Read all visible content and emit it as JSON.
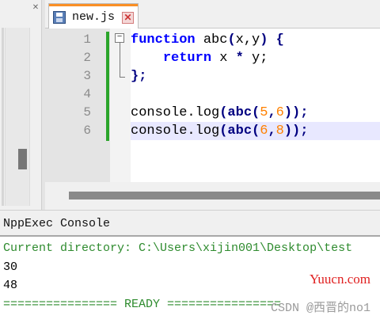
{
  "tab": {
    "filename": "new.js",
    "close_glyph": "✕"
  },
  "left_panel": {
    "close_glyph": "✕"
  },
  "editor": {
    "line_numbers": [
      "1",
      "2",
      "3",
      "4",
      "5",
      "6"
    ],
    "fold_glyph": "−",
    "lines": {
      "l1": {
        "kw": "function",
        "rest": " abc",
        "p1": "(",
        "args": "x,y",
        "p2": ")",
        "brace": " {"
      },
      "l2": {
        "indent": "    ",
        "kw": "return",
        "rest": " x ",
        "op": "*",
        "rest2": " y;"
      },
      "l3": {
        "text": "};"
      },
      "l5": {
        "a": "console.log",
        "b": "(abc(",
        "n1": "5",
        "c": ",",
        "n2": "6",
        "d": "));"
      },
      "l6": {
        "a": "console.log",
        "b": "(abc(",
        "n1": "6",
        "c": ",",
        "n2": "8",
        "d": "));"
      }
    }
  },
  "console": {
    "title": "NppExec Console",
    "lines": [
      "Current directory: C:\\Users\\xijin001\\Desktop\\test",
      "30",
      "48",
      "================ READY ================"
    ]
  },
  "watermarks": {
    "site": "Yuucn.com",
    "author": "CSDN @西晋的no1"
  }
}
